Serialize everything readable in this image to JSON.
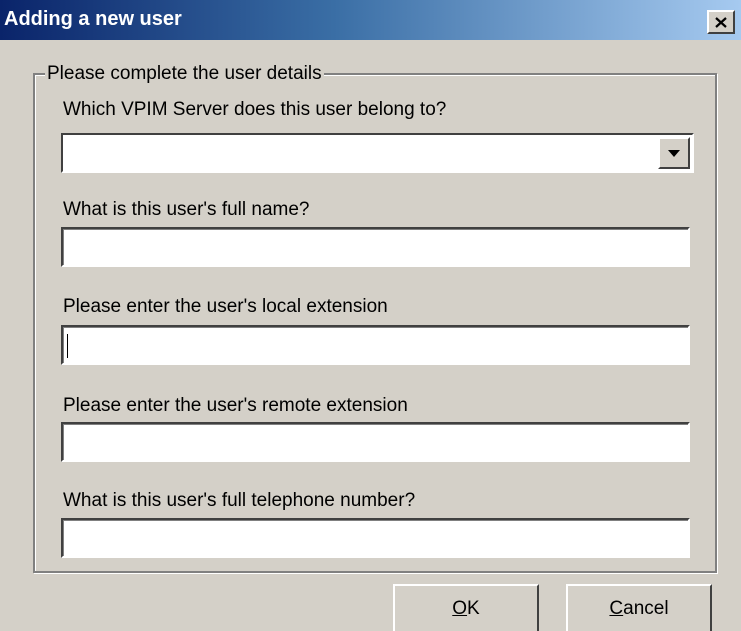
{
  "window": {
    "title": "Adding a new user"
  },
  "icons": {
    "close": "close-icon",
    "dropdown": "chevron-down-icon"
  },
  "group": {
    "legend": "Please complete the user details"
  },
  "fields": {
    "server": {
      "label": "Which VPIM Server does this user belong to?",
      "value": ""
    },
    "full_name": {
      "label": "What is this user's full name?",
      "value": ""
    },
    "local_extension": {
      "label": "Please enter the user's local extension",
      "value": ""
    },
    "remote_extension": {
      "label": "Please enter the user's remote extension",
      "value": ""
    },
    "telephone": {
      "label": "What is this user's full telephone number?",
      "value": ""
    }
  },
  "buttons": {
    "ok": {
      "mnemonic": "O",
      "rest": "K"
    },
    "cancel": {
      "mnemonic": "C",
      "rest": "ancel"
    }
  },
  "colors": {
    "dialog_face": "#d4d0c8",
    "title_start": "#0a246a",
    "title_end": "#a6caf0"
  }
}
